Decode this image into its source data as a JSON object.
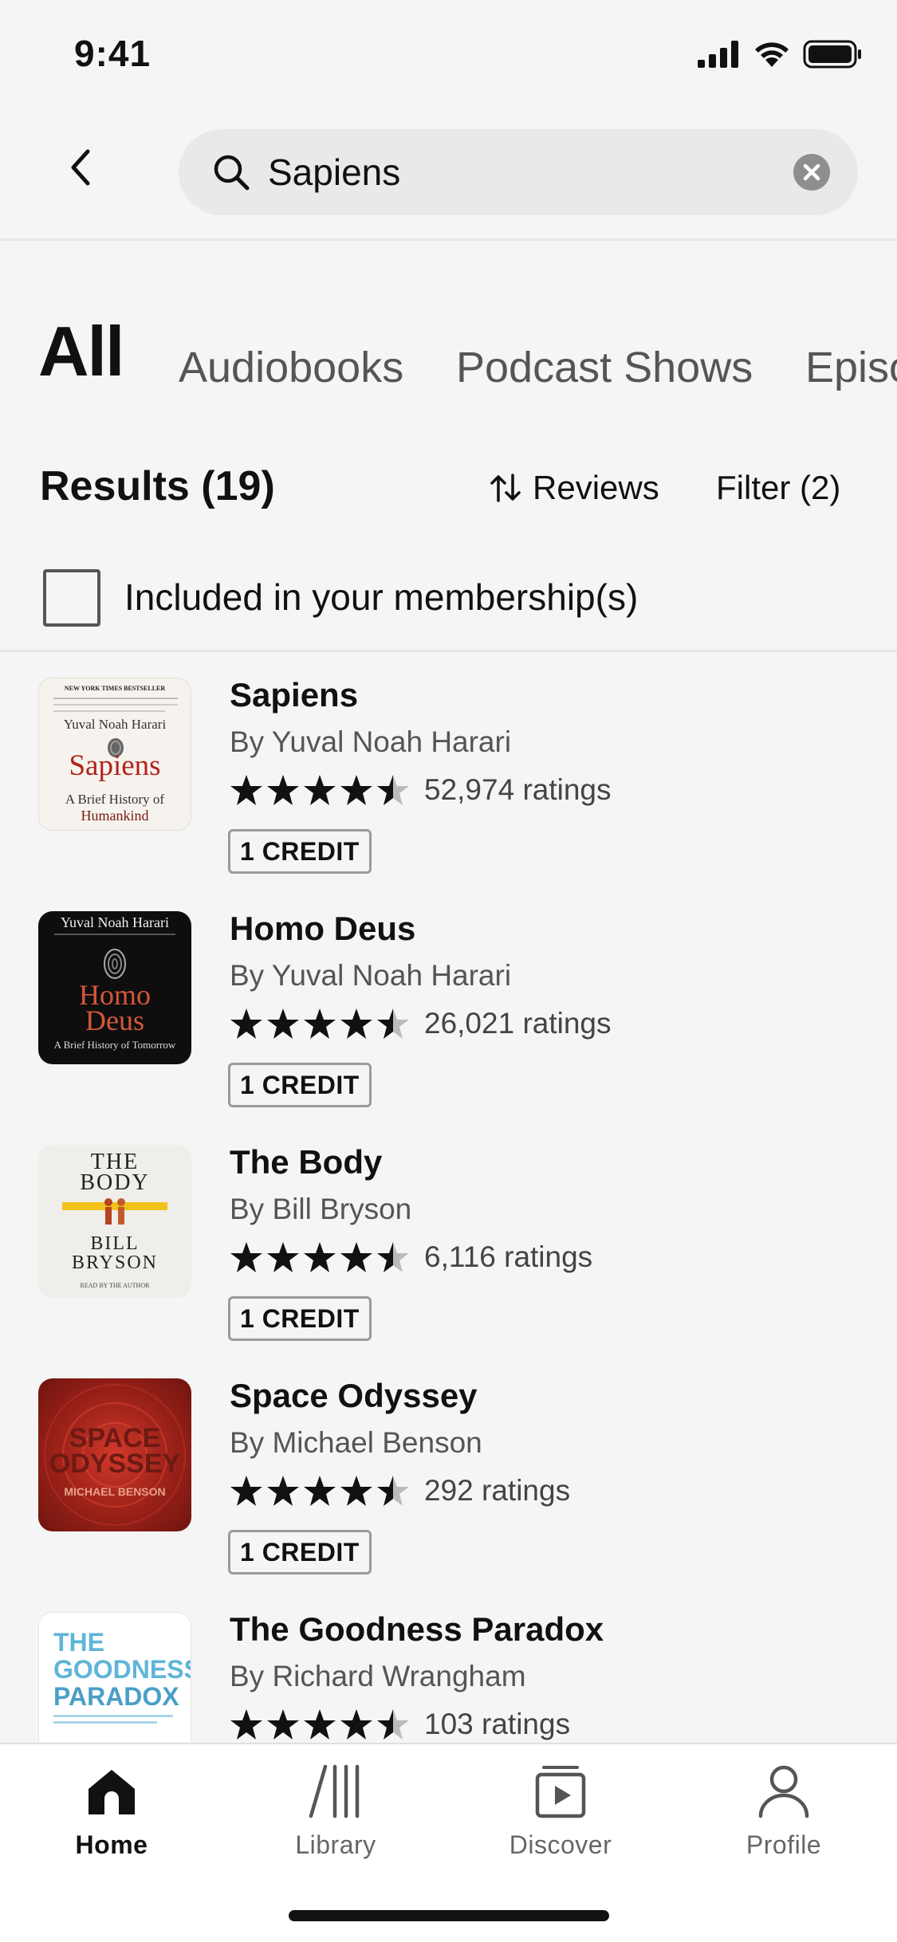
{
  "status_bar": {
    "time": "9:41"
  },
  "search": {
    "query": "Sapiens"
  },
  "tabs": [
    {
      "label": "All"
    },
    {
      "label": "Audiobooks"
    },
    {
      "label": "Podcast Shows"
    },
    {
      "label": "Episodes"
    }
  ],
  "results": {
    "title": "Results (19)",
    "sort_label": "Reviews",
    "filter_label": "Filter (2)"
  },
  "membership_filter": {
    "label": "Included in your membership(s)",
    "checked": false
  },
  "books": [
    {
      "title": "Sapiens",
      "author": "By Yuval Noah Harari",
      "rating": 4.5,
      "ratings_count": "52,974 ratings",
      "badge": "1 CREDIT",
      "cover": {
        "bg": "#f6f3ee",
        "lines": [
          "NEW YORK TIMES BESTSELLER",
          "Yuval Noah Harari",
          "Sapiens",
          "A Brief History of",
          "Humankind"
        ]
      }
    },
    {
      "title": "Homo Deus",
      "author": "By Yuval Noah Harari",
      "rating": 4.5,
      "ratings_count": "26,021 ratings",
      "badge": "1 CREDIT",
      "cover": {
        "bg": "#0e0e0e",
        "lines": [
          "Yuval Noah Harari",
          "Homo",
          "Deus",
          "A Brief History of Tomorrow"
        ]
      }
    },
    {
      "title": "The Body",
      "author": "By Bill Bryson",
      "rating": 4.5,
      "ratings_count": "6,116 ratings",
      "badge": "1 CREDIT",
      "cover": {
        "bg": "#efeeea",
        "lines": [
          "THE",
          "BODY",
          "BILL",
          "BRYSON",
          "READ BY THE AUTHOR"
        ]
      }
    },
    {
      "title": "Space Odyssey",
      "author": "By Michael Benson",
      "rating": 4.5,
      "ratings_count": "292 ratings",
      "badge": "1 CREDIT",
      "cover": {
        "bg": "#8c1c16",
        "lines": [
          "SPACE",
          "ODYSSEY",
          "MICHAEL BENSON"
        ]
      }
    },
    {
      "title": "The Goodness Paradox",
      "author": "By Richard Wrangham",
      "rating": 4.5,
      "ratings_count": "103 ratings",
      "badge": "",
      "cover": {
        "bg": "#ffffff",
        "lines": [
          "THE",
          "GOODNESS",
          "PARADOX"
        ]
      }
    }
  ],
  "tab_bar": [
    {
      "label": "Home",
      "icon": "home-icon",
      "active": true
    },
    {
      "label": "Library",
      "icon": "library-icon",
      "active": false
    },
    {
      "label": "Discover",
      "icon": "discover-icon",
      "active": false
    },
    {
      "label": "Profile",
      "icon": "profile-icon",
      "active": false
    }
  ]
}
